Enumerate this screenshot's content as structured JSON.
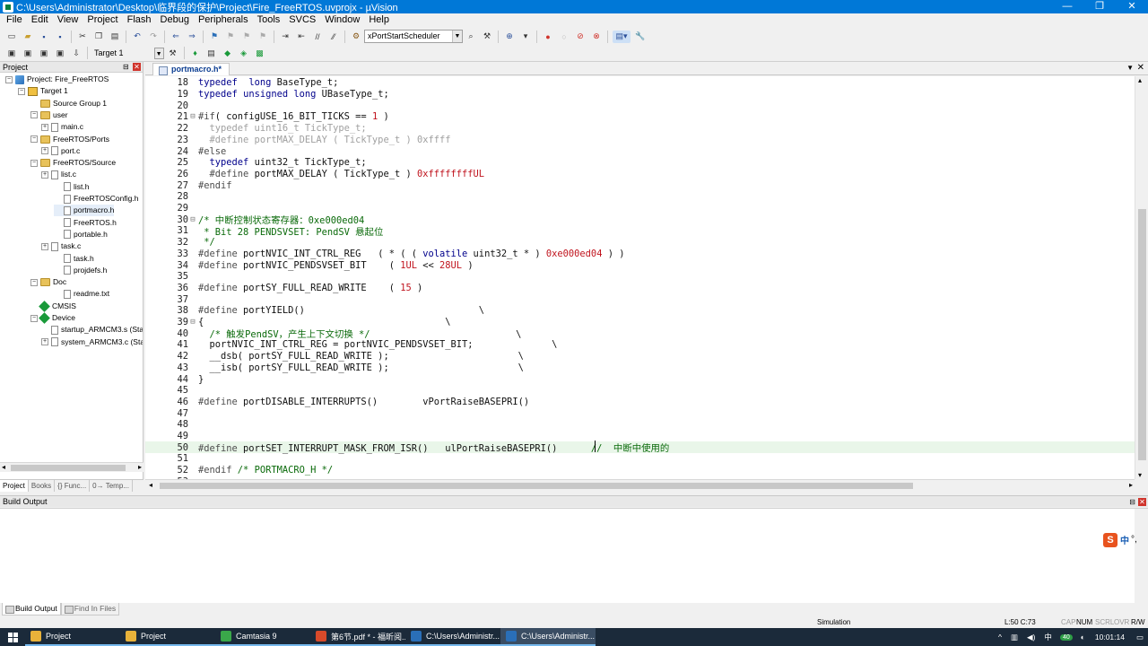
{
  "window": {
    "title": "C:\\Users\\Administrator\\Desktop\\临界段的保护\\Project\\Fire_FreeRTOS.uvprojx - µVision",
    "buttons": [
      "—",
      "❐",
      "✕"
    ]
  },
  "menu": [
    "File",
    "Edit",
    "View",
    "Project",
    "Flash",
    "Debug",
    "Peripherals",
    "Tools",
    "SVCS",
    "Window",
    "Help"
  ],
  "toolbar": {
    "function_combo": "xPortStartScheduler",
    "target": "Target 1"
  },
  "project_pane": {
    "title": "Project",
    "items": [
      {
        "label": "Project: Fire_FreeRTOS",
        "icon": "project-icon",
        "expander": "⊟"
      },
      {
        "label": "Target 1",
        "icon": "target-icon",
        "expander": "⊟"
      },
      {
        "label": "Source Group 1",
        "icon": "folder-icon",
        "expander": ""
      },
      {
        "label": "user",
        "icon": "folder-icon",
        "expander": "⊟"
      },
      {
        "label": "main.c",
        "icon": "file-icon",
        "expander": "⊞"
      },
      {
        "label": "FreeRTOS/Ports",
        "icon": "folder-icon",
        "expander": "⊟"
      },
      {
        "label": "port.c",
        "icon": "file-icon",
        "expander": "⊞"
      },
      {
        "label": "FreeRTOS/Source",
        "icon": "folder-icon",
        "expander": "⊟"
      },
      {
        "label": "list.c",
        "icon": "file-icon",
        "expander": "⊞"
      },
      {
        "label": "list.h",
        "icon": "file-icon",
        "expander": ""
      },
      {
        "label": "FreeRTOSConfig.h",
        "icon": "file-icon",
        "expander": ""
      },
      {
        "label": "portmacro.h",
        "icon": "file-icon",
        "expander": ""
      },
      {
        "label": "FreeRTOS.h",
        "icon": "file-icon",
        "expander": ""
      },
      {
        "label": "portable.h",
        "icon": "file-icon",
        "expander": ""
      },
      {
        "label": "task.c",
        "icon": "file-icon",
        "expander": "⊞"
      },
      {
        "label": "task.h",
        "icon": "file-icon",
        "expander": ""
      },
      {
        "label": "projdefs.h",
        "icon": "file-icon",
        "expander": ""
      },
      {
        "label": "Doc",
        "icon": "folder-icon",
        "expander": "⊟"
      },
      {
        "label": "readme.txt",
        "icon": "file-icon",
        "expander": ""
      },
      {
        "label": "CMSIS",
        "icon": "gem-icon",
        "expander": ""
      },
      {
        "label": "Device",
        "icon": "gem-icon",
        "expander": "⊟"
      },
      {
        "label": "startup_ARMCM3.s (Start",
        "icon": "file-icon",
        "expander": ""
      },
      {
        "label": "system_ARMCM3.c (Start",
        "icon": "file-icon",
        "expander": "⊞"
      }
    ],
    "tabs": [
      "Project",
      "Books",
      "{} Func...",
      "0→ Temp..."
    ]
  },
  "editor": {
    "tab": "portmacro.h*",
    "current_line": 50,
    "lines": [
      {
        "n": "18",
        "fold": "",
        "parts": [
          [
            "kw",
            "typedef"
          ],
          [
            "",
            "  "
          ],
          [
            "kw",
            "long"
          ],
          [
            "",
            " BaseType_t;"
          ]
        ]
      },
      {
        "n": "19",
        "fold": "",
        "parts": [
          [
            "kw",
            "typedef"
          ],
          [
            "",
            " "
          ],
          [
            "kw",
            "unsigned"
          ],
          [
            "",
            " "
          ],
          [
            "kw",
            "long"
          ],
          [
            "",
            " UBaseType_t;"
          ]
        ]
      },
      {
        "n": "20",
        "fold": "",
        "parts": []
      },
      {
        "n": "21",
        "fold": "⊟",
        "parts": [
          [
            "pp",
            "#if"
          ],
          [
            "",
            "( configUSE_16_BIT_TICKS == "
          ],
          [
            "num",
            "1"
          ],
          [
            "",
            " )"
          ]
        ]
      },
      {
        "n": "22",
        "fold": "",
        "parts": [
          [
            "dim",
            "  typedef uint16_t TickType_t;"
          ]
        ]
      },
      {
        "n": "23",
        "fold": "",
        "parts": [
          [
            "dim",
            "  #define portMAX_DELAY ( TickType_t ) 0xffff"
          ]
        ]
      },
      {
        "n": "24",
        "fold": "",
        "parts": [
          [
            "pp",
            "#else"
          ]
        ]
      },
      {
        "n": "25",
        "fold": "",
        "parts": [
          [
            "",
            "  "
          ],
          [
            "kw",
            "typedef"
          ],
          [
            "",
            " uint32_t TickType_t;"
          ]
        ]
      },
      {
        "n": "26",
        "fold": "",
        "parts": [
          [
            "",
            "  "
          ],
          [
            "pp",
            "#define"
          ],
          [
            "",
            " portMAX_DELAY ( TickType_t ) "
          ],
          [
            "num",
            "0xffffffffUL"
          ]
        ]
      },
      {
        "n": "27",
        "fold": "",
        "parts": [
          [
            "pp",
            "#endif"
          ]
        ]
      },
      {
        "n": "28",
        "fold": "",
        "parts": []
      },
      {
        "n": "29",
        "fold": "",
        "parts": []
      },
      {
        "n": "30",
        "fold": "⊟",
        "parts": [
          [
            "cmt",
            "/* 中断控制状态寄存器：0xe000ed04"
          ]
        ]
      },
      {
        "n": "31",
        "fold": "",
        "parts": [
          [
            "cmt",
            " * Bit 28 PENDSVSET: PendSV 悬起位"
          ]
        ]
      },
      {
        "n": "32",
        "fold": "",
        "parts": [
          [
            "cmt",
            " */"
          ]
        ]
      },
      {
        "n": "33",
        "fold": "",
        "parts": [
          [
            "pp",
            "#define"
          ],
          [
            "",
            " portNVIC_INT_CTRL_REG   ( * ( ( "
          ],
          [
            "kw",
            "volatile"
          ],
          [
            "",
            " uint32_t * ) "
          ],
          [
            "num",
            "0xe000ed04"
          ],
          [
            "",
            " ) )"
          ]
        ]
      },
      {
        "n": "34",
        "fold": "",
        "parts": [
          [
            "pp",
            "#define"
          ],
          [
            "",
            " portNVIC_PENDSVSET_BIT    ( "
          ],
          [
            "num",
            "1UL"
          ],
          [
            "",
            " << "
          ],
          [
            "num",
            "28UL"
          ],
          [
            "",
            " )"
          ]
        ]
      },
      {
        "n": "35",
        "fold": "",
        "parts": []
      },
      {
        "n": "36",
        "fold": "",
        "parts": [
          [
            "pp",
            "#define"
          ],
          [
            "",
            " portSY_FULL_READ_WRITE    ( "
          ],
          [
            "num",
            "15"
          ],
          [
            "",
            " )"
          ]
        ]
      },
      {
        "n": "37",
        "fold": "",
        "parts": []
      },
      {
        "n": "38",
        "fold": "",
        "parts": [
          [
            "pp",
            "#define"
          ],
          [
            "",
            " portYIELD()                               \\"
          ]
        ]
      },
      {
        "n": "39",
        "fold": "⊟",
        "parts": [
          [
            "",
            "{                                           \\"
          ]
        ]
      },
      {
        "n": "40",
        "fold": "",
        "parts": [
          [
            "",
            "  "
          ],
          [
            "cmt",
            "/* 触发PendSV，产生上下文切换 */"
          ],
          [
            "",
            "                          \\"
          ]
        ]
      },
      {
        "n": "41",
        "fold": "",
        "parts": [
          [
            "",
            "  portNVIC_INT_CTRL_REG = portNVIC_PENDSVSET_BIT;              \\"
          ]
        ]
      },
      {
        "n": "42",
        "fold": "",
        "parts": [
          [
            "",
            "  __dsb( portSY_FULL_READ_WRITE );                       \\"
          ]
        ]
      },
      {
        "n": "43",
        "fold": "",
        "parts": [
          [
            "",
            "  __isb( portSY_FULL_READ_WRITE );                       \\"
          ]
        ]
      },
      {
        "n": "44",
        "fold": "",
        "parts": [
          [
            "",
            "}"
          ]
        ]
      },
      {
        "n": "45",
        "fold": "",
        "parts": []
      },
      {
        "n": "46",
        "fold": "",
        "parts": [
          [
            "pp",
            "#define"
          ],
          [
            "",
            " portDISABLE_INTERRUPTS()        vPortRaiseBASEPRI()"
          ]
        ]
      },
      {
        "n": "47",
        "fold": "",
        "parts": []
      },
      {
        "n": "48",
        "fold": "",
        "parts": []
      },
      {
        "n": "49",
        "fold": "",
        "parts": []
      },
      {
        "n": "50",
        "fold": "",
        "parts": [
          [
            "pp",
            "#define"
          ],
          [
            "",
            " portSET_INTERRUPT_MASK_FROM_ISR()   ulPortRaiseBASEPRI()      "
          ],
          [
            "cmt",
            "//  中断中使用的"
          ]
        ]
      },
      {
        "n": "51",
        "fold": "",
        "parts": []
      },
      {
        "n": "52",
        "fold": "",
        "parts": [
          [
            "pp",
            "#endif"
          ],
          [
            "cmt",
            " /* PORTMACRO_H */"
          ]
        ]
      },
      {
        "n": "53",
        "fold": "",
        "parts": []
      }
    ]
  },
  "build_output": {
    "title": "Build Output",
    "tabs": [
      "Build Output",
      "Find In Files"
    ],
    "ime": {
      "s": "S",
      "label": "中",
      "extra": "°,"
    }
  },
  "statusbar": {
    "mode": "Simulation",
    "position": "L:50 C:73",
    "cap": "CAP",
    "num": "NUM",
    "scrl": "SCRL",
    "ovr": "OVR",
    "rw": "R/W"
  },
  "taskbar": {
    "items": [
      {
        "label": "Project",
        "color": "#e8b23a",
        "active": false
      },
      {
        "label": "Project",
        "color": "#e8b23a",
        "active": false
      },
      {
        "label": "Camtasia 9",
        "color": "#3aa84a",
        "active": false
      },
      {
        "label": "第6节.pdf * - 福昕阅...",
        "color": "#d84a2a",
        "active": false
      },
      {
        "label": "C:\\Users\\Administr...",
        "color": "#2a6fb8",
        "active": false
      },
      {
        "label": "C:\\Users\\Administr...",
        "color": "#2a6fb8",
        "active": true
      }
    ],
    "tray": {
      "ime": "中",
      "badge": "40",
      "time": "10:01:14",
      "chevron": "^"
    }
  }
}
